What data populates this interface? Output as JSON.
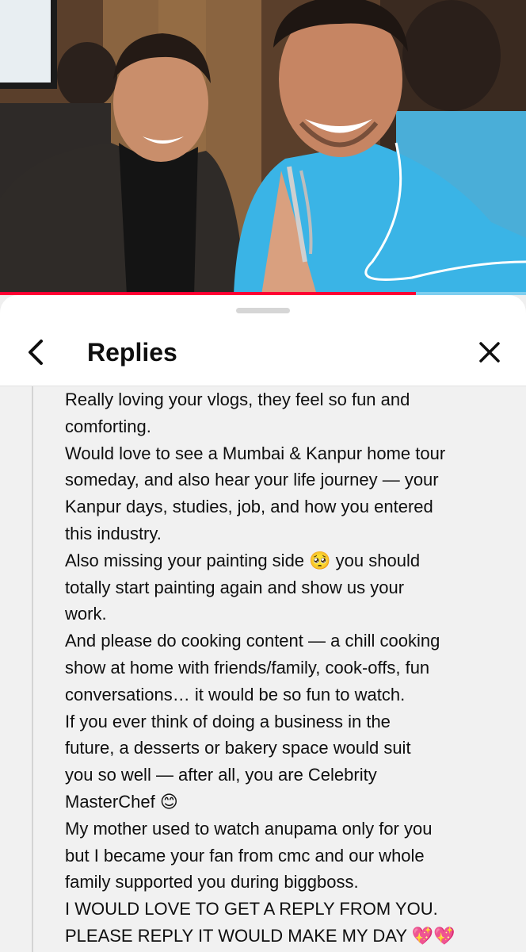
{
  "video": {
    "progress_fraction": 0.79
  },
  "sheet": {
    "title": "Replies",
    "back_icon": "chevron-left-icon",
    "close_icon": "close-icon"
  },
  "comment": {
    "lines": [
      "Really loving your vlogs, they feel so fun and",
      "comforting.",
      "Would love to see a Mumbai & Kanpur home tour",
      "someday, and also hear your life journey — your",
      "Kanpur days, studies, job, and how you entered",
      "this industry.",
      "Also missing your painting side 🥺 you should",
      "totally start painting again and show us your",
      "work.",
      "And please do cooking content — a chill cooking",
      "show at home with friends/family, cook-offs, fun",
      "conversations… it would be so fun to watch.",
      "If you ever think of doing a business in the",
      "future, a desserts or bakery space would suit",
      "you so well — after all, you are Celebrity",
      "MasterChef 😊",
      "My mother used to watch anupama only for you",
      "but I became your fan from cmc and our whole",
      "family supported you during biggboss.",
      "I WOULD LOVE TO GET A REPLY FROM YOU.",
      "PLEASE REPLY IT WOULD MAKE MY DAY 💖💖"
    ]
  },
  "colors": {
    "progress": "#ff0033",
    "jacket": "#3ab4e6",
    "sheet_bg": "#ffffff",
    "content_bg": "#f1f1f1"
  }
}
